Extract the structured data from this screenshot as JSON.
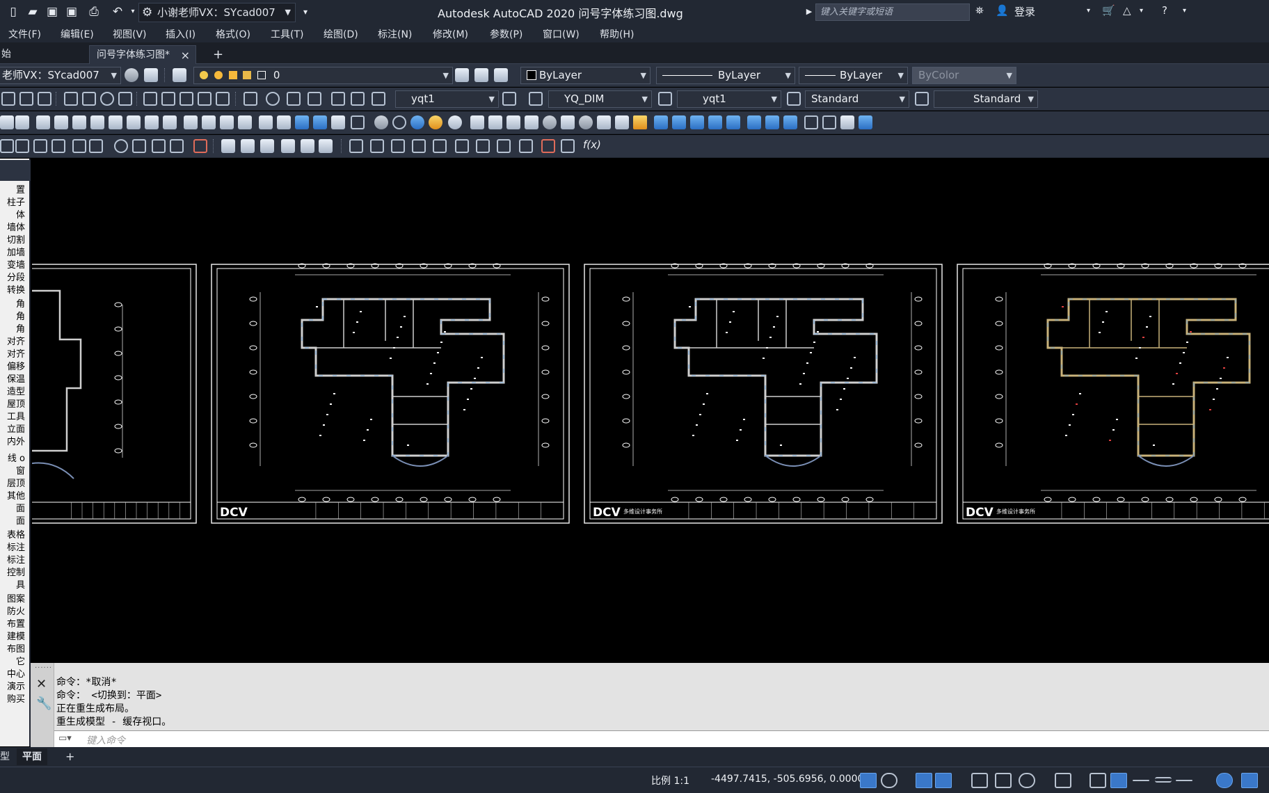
{
  "title_bar": {
    "workspace": "小谢老师VX：SYcad007",
    "app_title": "Autodesk AutoCAD 2020    问号字体练习图.dwg",
    "search_placeholder": "键入关键字或短语",
    "login_label": "登录"
  },
  "menu": [
    "文件(F)",
    "编辑(E)",
    "视图(V)",
    "插入(I)",
    "格式(O)",
    "工具(T)",
    "绘图(D)",
    "标注(N)",
    "修改(M)",
    "参数(P)",
    "窗口(W)",
    "帮助(H)"
  ],
  "tabs": {
    "start_partial": "始",
    "active": "问号字体练习图*",
    "close_glyph": "×",
    "add_glyph": "+"
  },
  "toolbar": {
    "layer_state": "老师VX：SYcad007",
    "layer_name": "0",
    "color": "ByLayer",
    "linetype": "ByLayer",
    "lineweight": "ByLayer",
    "plotstyle": "ByColor",
    "text_style": "yqt1",
    "dim_style": "YQ_DIM",
    "multileader_style": "yqt1",
    "table_style": "Standard",
    "mleader_style2": "Standard",
    "fx_label": "f(x)"
  },
  "palette": {
    "items": [
      "置",
      "柱子",
      "体",
      "墙体",
      "切割",
      "加墙",
      "变墙",
      "分段",
      "转换",
      "角",
      "角",
      "角",
      "对齐",
      "对齐",
      "偏移",
      "保温",
      "造型",
      "屋顶",
      "工具",
      "立面",
      "内外",
      "线 o",
      "窗",
      "层顶",
      "其他",
      "面",
      "面",
      "表格",
      "标注",
      "标注",
      "控制",
      "具",
      "图案",
      "防火",
      "布置",
      "建模",
      "布图",
      "它",
      "中心",
      "演示",
      "购买"
    ]
  },
  "sheets": [
    {
      "logo": "",
      "firm": ""
    },
    {
      "logo": "DCV",
      "firm": ""
    },
    {
      "logo": "DCV",
      "firm": "多维设计事务所"
    },
    {
      "logo": "DCV",
      "firm": "多维设计事务所"
    }
  ],
  "command": {
    "history": [
      "命令：*取消*",
      "命令：  <切换到：平面>",
      "正在重生成布局。",
      "重生成模型 - 缓存视口。"
    ],
    "input_placeholder": "键入命令"
  },
  "layout_tabs": {
    "model_partial": "型",
    "active": "平面",
    "add": "+"
  },
  "status": {
    "scale": "比例 1:1",
    "coordinates": "-4497.7415, -505.6956, 0.0000"
  }
}
